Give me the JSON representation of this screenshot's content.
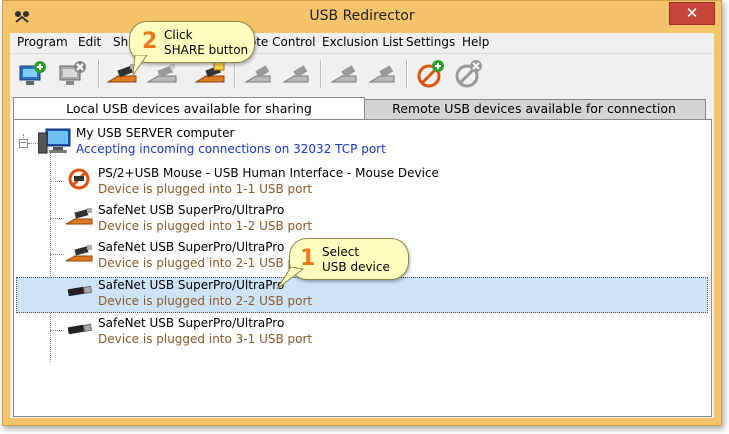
{
  "window": {
    "title": "USB Redirector",
    "close_label": "✕"
  },
  "menu": [
    "Program",
    "Edit",
    "Share",
    "Remote Control",
    "Exclusion List",
    "Settings",
    "Help"
  ],
  "tabs": {
    "local": "Local USB devices available for sharing",
    "remote": "Remote USB devices available for connection"
  },
  "server": {
    "name": "My USB SERVER computer",
    "status": "Accepting incoming connections on 32032 TCP port"
  },
  "devices": [
    {
      "name": "PS/2+USB Mouse - USB Human Interface - Mouse Device",
      "status": "Device is plugged into 1-1 USB port",
      "icon": "blocked-device-icon"
    },
    {
      "name": "SafeNet USB SuperPro/UltraPro",
      "status": "Device is plugged into 1-2 USB port",
      "icon": "shared-usb-icon"
    },
    {
      "name": "SafeNet USB SuperPro/UltraPro",
      "status": "Device is plugged into 2-1 USB port",
      "icon": "shared-usb-icon"
    },
    {
      "name": "SafeNet USB SuperPro/UltraPro",
      "status": "Device is plugged into 2-2 USB port",
      "icon": "usb-plug-icon",
      "selected": true
    },
    {
      "name": "SafeNet USB SuperPro/UltraPro",
      "status": "Device is plugged into 3-1 USB port",
      "icon": "usb-plug-icon"
    }
  ],
  "callouts": {
    "share": {
      "number": "2",
      "line1": "Click",
      "line2": "SHARE button"
    },
    "select": {
      "number": "1",
      "line1": "Select",
      "line2": "USB device"
    }
  },
  "colors": {
    "frame": "#f5c36a",
    "close": "#c7463a",
    "selection": "#cde4f7",
    "status_blue": "#1a35d6",
    "status_brown": "#8b5a2b",
    "callout_number": "#f07818"
  }
}
